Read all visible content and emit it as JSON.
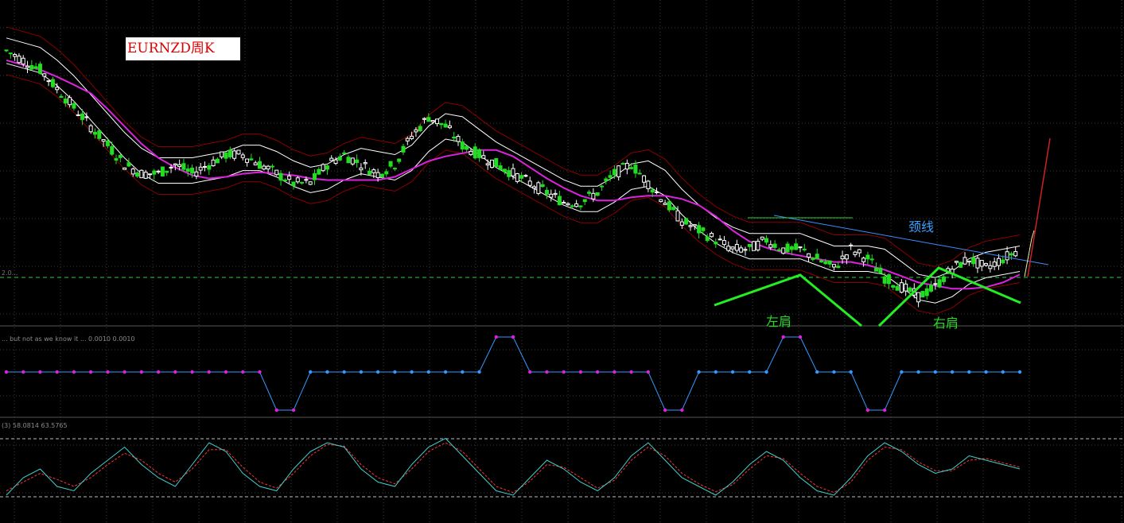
{
  "symbol_label": "EURNZD周K",
  "annotations": {
    "neckline": "颈线",
    "left_shoulder": "左肩",
    "right_shoulder": "右肩"
  },
  "panel_labels": {
    "indicator1": "... but not as we know it ... 0.0010 0.0010",
    "indicator2": "(3) 58.0814 63.5765",
    "price_level": "2.0..."
  },
  "colors": {
    "background": "#000000",
    "bull_candle": "#22dd22",
    "bear_candle": "#ffffff",
    "moving_average": "#dd22dd",
    "envelope_inner": "#ffffff",
    "envelope_outer": "#8b0000",
    "neckline": "#3a8fff",
    "pattern_lines": "#22ee22",
    "indicator_low": "#dd22dd",
    "indicator_high": "#3399ff",
    "stoch_main": "#40d0d0",
    "stoch_signal": "#ff3333"
  },
  "chart_data": {
    "type": "candlestick",
    "title": "EURNZD周K",
    "close_trend": [
      2.07,
      2.06,
      2.05,
      2.03,
      2.01,
      1.99,
      1.97,
      1.95,
      1.94,
      1.94,
      1.95,
      1.94,
      1.95,
      1.96,
      1.96,
      1.95,
      1.94,
      1.93,
      1.93,
      1.95,
      1.96,
      1.95,
      1.94,
      1.95,
      1.98,
      2.0,
      1.99,
      1.97,
      1.96,
      1.95,
      1.94,
      1.93,
      1.92,
      1.91,
      1.91,
      1.92,
      1.94,
      1.95,
      1.93,
      1.91,
      1.89,
      1.88,
      1.87,
      1.86,
      1.86,
      1.87,
      1.86,
      1.86,
      1.85,
      1.84,
      1.86,
      1.85,
      1.83,
      1.82,
      1.81,
      1.82,
      1.84,
      1.85,
      1.84,
      1.85,
      1.86
    ],
    "indicator1_series": [
      0,
      0,
      0,
      0,
      0,
      0,
      0,
      0,
      0,
      0,
      0,
      0,
      0,
      0,
      0,
      0,
      -1,
      -1,
      0,
      0,
      0,
      0,
      0,
      0,
      0,
      0,
      0,
      0,
      0,
      1,
      1,
      0,
      0,
      0,
      0,
      0,
      0,
      0,
      0,
      -1,
      -1,
      0,
      0,
      0,
      0,
      0,
      1,
      1,
      0,
      0,
      0,
      -1,
      -1,
      0,
      0,
      0,
      0,
      0,
      0,
      0,
      0
    ],
    "stochastic": {
      "main": [
        20,
        40,
        50,
        30,
        25,
        45,
        60,
        75,
        55,
        40,
        30,
        55,
        80,
        70,
        45,
        30,
        25,
        50,
        70,
        80,
        75,
        50,
        35,
        30,
        55,
        75,
        85,
        65,
        45,
        25,
        20,
        40,
        60,
        50,
        35,
        25,
        40,
        65,
        80,
        60,
        40,
        30,
        20,
        35,
        55,
        70,
        60,
        40,
        25,
        20,
        40,
        65,
        80,
        70,
        55,
        45,
        50,
        65,
        60,
        55,
        50
      ],
      "signal": [
        25,
        35,
        45,
        38,
        30,
        40,
        55,
        68,
        60,
        45,
        35,
        50,
        72,
        72,
        52,
        35,
        28,
        45,
        65,
        78,
        76,
        55,
        40,
        33,
        50,
        70,
        80,
        70,
        50,
        30,
        23,
        36,
        55,
        52,
        40,
        28,
        37,
        60,
        75,
        65,
        45,
        33,
        24,
        32,
        50,
        65,
        62,
        45,
        30,
        23,
        35,
        60,
        75,
        72,
        58,
        48,
        48,
        60,
        62,
        57,
        52
      ]
    }
  }
}
